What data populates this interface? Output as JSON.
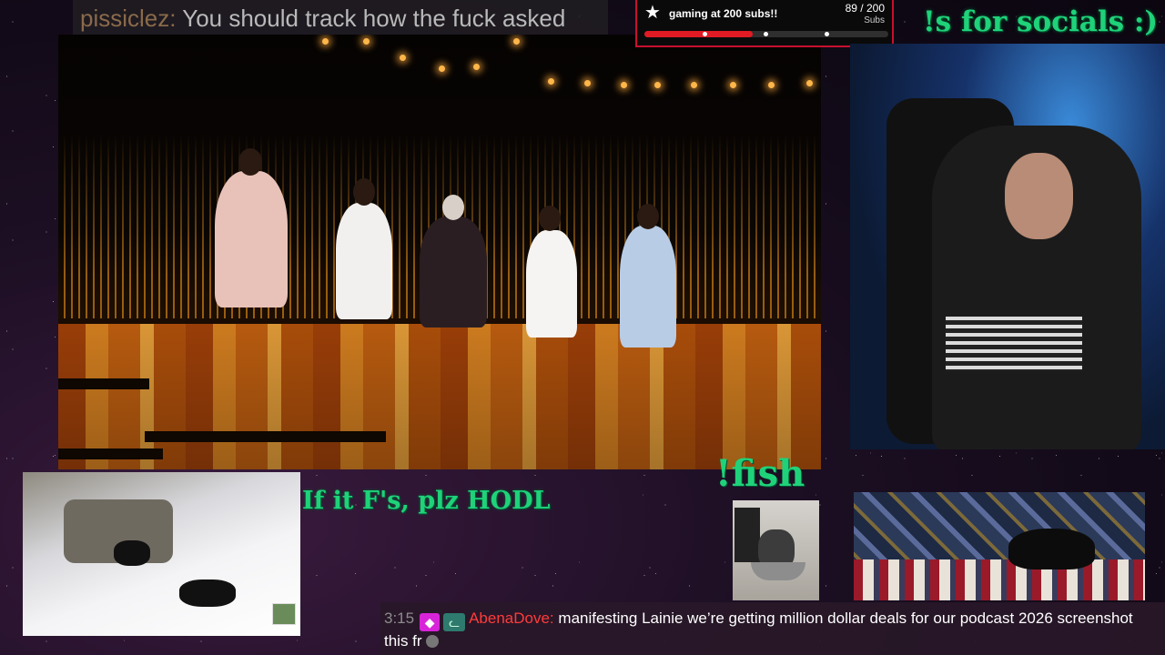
{
  "top_chat": {
    "username": "pissiclez:",
    "message": "You should track how the fuck asked"
  },
  "sub_goal": {
    "icon": "star-icon",
    "title": "gaming at 200 subs!!",
    "count": "89 / 200",
    "unit": "Subs",
    "progress": 0.445,
    "accent_color": "#c8102e"
  },
  "overlay_text": {
    "socials": "!s for socials :)",
    "hodl": "If it F's, plz HODL",
    "fish": "!fish"
  },
  "bottom_chat": {
    "time": "3:15",
    "badge1_icon": "diamond-icon",
    "badge2_icon": "cat-badge-icon",
    "username": "AbenaDove:",
    "message_line1": "manifesting Lainie we’re getting million dollar deals for our podcast 2026 screenshot",
    "message_line2": "this fr",
    "emote_icon": "emote-icon"
  },
  "colors": {
    "overlay_green": "#1fd27a",
    "chat_name": "#ff3b3b"
  }
}
